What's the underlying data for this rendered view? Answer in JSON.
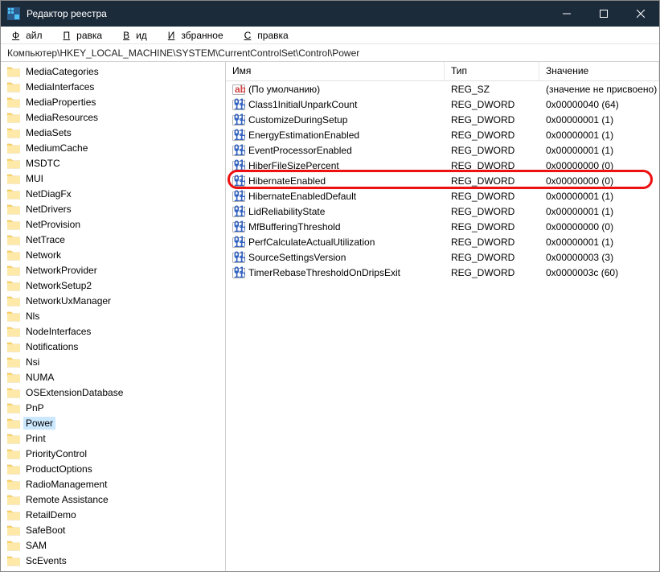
{
  "window": {
    "title": "Редактор реестра"
  },
  "menu": {
    "file": "Файл",
    "edit": "Правка",
    "view": "Вид",
    "favorites": "Избранное",
    "help": "Справка"
  },
  "address": "Компьютер\\HKEY_LOCAL_MACHINE\\SYSTEM\\CurrentControlSet\\Control\\Power",
  "columns": {
    "name": "Имя",
    "type": "Тип",
    "value": "Значение"
  },
  "tree": [
    "MediaCategories",
    "MediaInterfaces",
    "MediaProperties",
    "MediaResources",
    "MediaSets",
    "MediumCache",
    "MSDTC",
    "MUI",
    "NetDiagFx",
    "NetDrivers",
    "NetProvision",
    "NetTrace",
    "Network",
    "NetworkProvider",
    "NetworkSetup2",
    "NetworkUxManager",
    "Nls",
    "NodeInterfaces",
    "Notifications",
    "Nsi",
    "NUMA",
    "OSExtensionDatabase",
    "PnP",
    "Power",
    "Print",
    "PriorityControl",
    "ProductOptions",
    "RadioManagement",
    "Remote Assistance",
    "RetailDemo",
    "SafeBoot",
    "SAM",
    "ScEvents"
  ],
  "treeSelected": "Power",
  "values": [
    {
      "icon": "sz",
      "name": "(По умолчанию)",
      "type": "REG_SZ",
      "data": "(значение не присвоено)"
    },
    {
      "icon": "bin",
      "name": "Class1InitialUnparkCount",
      "type": "REG_DWORD",
      "data": "0x00000040 (64)"
    },
    {
      "icon": "bin",
      "name": "CustomizeDuringSetup",
      "type": "REG_DWORD",
      "data": "0x00000001 (1)"
    },
    {
      "icon": "bin",
      "name": "EnergyEstimationEnabled",
      "type": "REG_DWORD",
      "data": "0x00000001 (1)"
    },
    {
      "icon": "bin",
      "name": "EventProcessorEnabled",
      "type": "REG_DWORD",
      "data": "0x00000001 (1)"
    },
    {
      "icon": "bin",
      "name": "HiberFileSizePercent",
      "type": "REG_DWORD",
      "data": "0x00000000 (0)"
    },
    {
      "icon": "bin",
      "name": "HibernateEnabled",
      "type": "REG_DWORD",
      "data": "0x00000000 (0)"
    },
    {
      "icon": "bin",
      "name": "HibernateEnabledDefault",
      "type": "REG_DWORD",
      "data": "0x00000001 (1)"
    },
    {
      "icon": "bin",
      "name": "LidReliabilityState",
      "type": "REG_DWORD",
      "data": "0x00000001 (1)"
    },
    {
      "icon": "bin",
      "name": "MfBufferingThreshold",
      "type": "REG_DWORD",
      "data": "0x00000000 (0)"
    },
    {
      "icon": "bin",
      "name": "PerfCalculateActualUtilization",
      "type": "REG_DWORD",
      "data": "0x00000001 (1)"
    },
    {
      "icon": "bin",
      "name": "SourceSettingsVersion",
      "type": "REG_DWORD",
      "data": "0x00000003 (3)"
    },
    {
      "icon": "bin",
      "name": "TimerRebaseThresholdOnDripsExit",
      "type": "REG_DWORD",
      "data": "0x0000003c (60)"
    }
  ],
  "highlightRow": 6
}
